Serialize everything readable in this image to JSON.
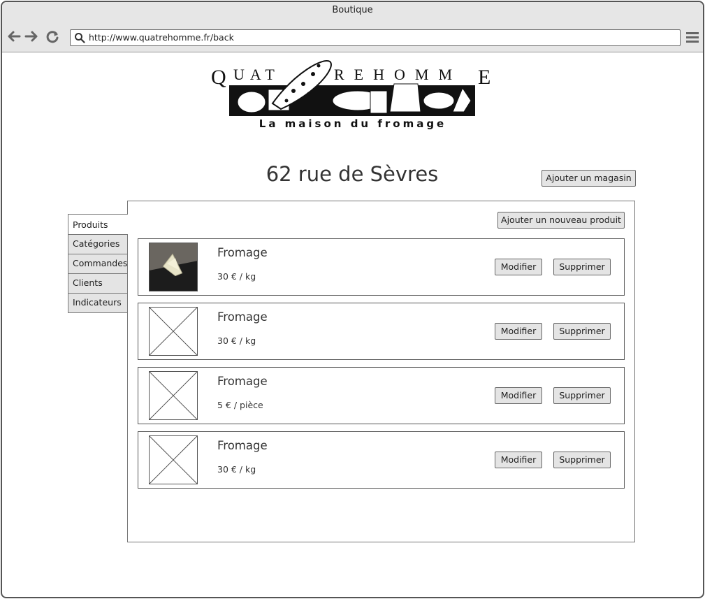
{
  "window": {
    "title": "Boutique"
  },
  "browser": {
    "url": "http://www.quatrehomme.fr/back"
  },
  "logo": {
    "top_text": "QUATREHOMME",
    "tagline": "La maison du fromage"
  },
  "store": {
    "title": "62 rue de Sèvres",
    "add_store_label": "Ajouter un magasin"
  },
  "tabs": [
    {
      "label": "Produits",
      "active": true
    },
    {
      "label": "Catégories",
      "active": false
    },
    {
      "label": "Commandes",
      "active": false
    },
    {
      "label": "Clients",
      "active": false
    },
    {
      "label": "Indicateurs",
      "active": false
    }
  ],
  "panel": {
    "add_product_label": "Ajouter un nouveau produit"
  },
  "products": [
    {
      "name": "Fromage",
      "price": "30 € / kg",
      "image": "cheese-photo",
      "edit_label": "Modifier",
      "delete_label": "Supprimer"
    },
    {
      "name": "Fromage",
      "price": "30 € / kg",
      "image": "image-placeholder",
      "edit_label": "Modifier",
      "delete_label": "Supprimer"
    },
    {
      "name": "Fromage",
      "price": "5 € / pièce",
      "image": "image-placeholder",
      "edit_label": "Modifier",
      "delete_label": "Supprimer"
    },
    {
      "name": "Fromage",
      "price": "30 € / kg",
      "image": "image-placeholder",
      "edit_label": "Modifier",
      "delete_label": "Supprimer"
    }
  ]
}
